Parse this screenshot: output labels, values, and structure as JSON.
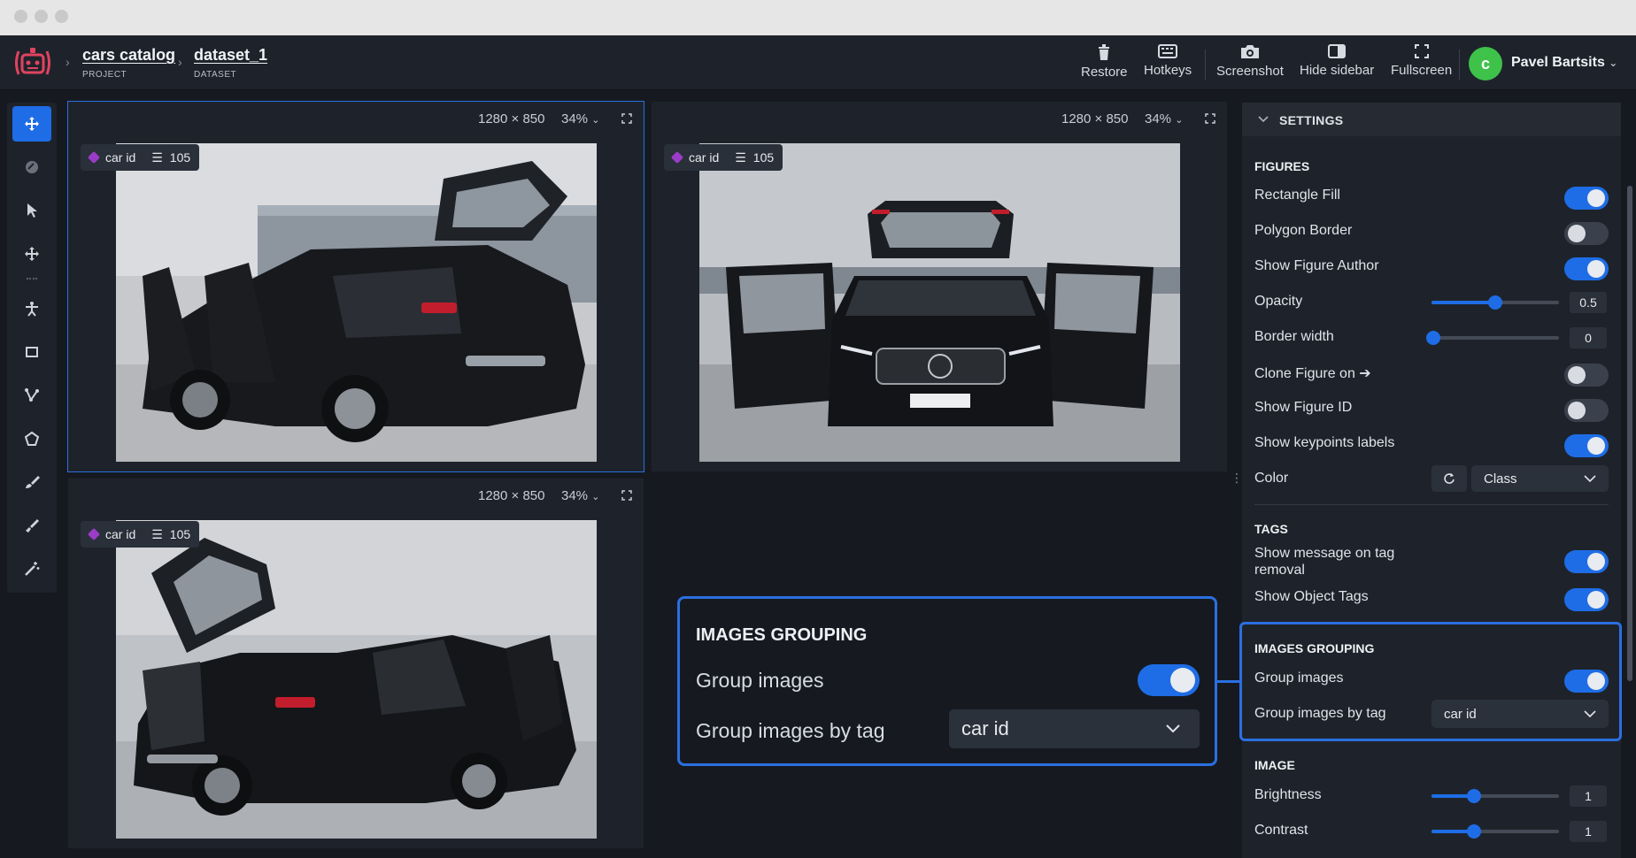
{
  "breadcrumb": [
    {
      "title": "cars catalog",
      "sub": "PROJECT"
    },
    {
      "title": "dataset_1",
      "sub": "DATASET"
    }
  ],
  "header_buttons": {
    "restore": "Restore",
    "hotkeys": "Hotkeys",
    "screenshot": "Screenshot",
    "hide_sidebar": "Hide sidebar",
    "fullscreen": "Fullscreen"
  },
  "user": {
    "initial": "c",
    "name": "Pavel Bartsits"
  },
  "tools": [
    "move-icon",
    "magic-fill-icon",
    "pointer-icon",
    "drag-icon",
    "keypoint-icon",
    "rectangle-icon",
    "polyline-icon",
    "polygon-icon",
    "brush-icon",
    "eraser-icon",
    "smart-tool-icon"
  ],
  "panels": [
    {
      "size": "1280 × 850",
      "zoom": "34%",
      "tag": "car id",
      "count": "105"
    },
    {
      "size": "1280 × 850",
      "zoom": "34%",
      "tag": "car id",
      "count": "105"
    },
    {
      "size": "1280 × 850",
      "zoom": "34%",
      "tag": "car id",
      "count": "105"
    }
  ],
  "callout": {
    "title": "IMAGES GROUPING",
    "group_images": "Group images",
    "group_by_tag": "Group images by tag",
    "tag_value": "car id"
  },
  "settings": {
    "title": "SETTINGS",
    "figures_title": "FIGURES",
    "rectangle_fill": "Rectangle Fill",
    "polygon_border": "Polygon Border",
    "show_figure_author": "Show Figure Author",
    "opacity": "Opacity",
    "opacity_value": "0.5",
    "border_width": "Border width",
    "border_width_value": "0",
    "clone_figure_on": "Clone Figure on ➔",
    "show_figure_id": "Show Figure ID",
    "show_keypoints_labels": "Show keypoints labels",
    "color": "Color",
    "color_mode": "Class",
    "tags_title": "TAGS",
    "show_message_on_tag_removal": "Show message on tag removal",
    "show_object_tags": "Show Object Tags",
    "grouping_title": "IMAGES GROUPING",
    "group_images": "Group images",
    "group_images_by_tag": "Group images by tag",
    "group_tag_value": "car id",
    "image_title": "IMAGE",
    "brightness": "Brightness",
    "brightness_value": "1",
    "contrast": "Contrast",
    "contrast_value": "1"
  },
  "toggles": {
    "rectangle_fill": true,
    "polygon_border": false,
    "show_figure_author": true,
    "clone_figure_on": false,
    "show_figure_id": false,
    "show_keypoints_labels": true,
    "show_message_on_tag_removal": true,
    "show_object_tags": true,
    "group_images": true
  },
  "sliders": {
    "opacity": 0.5,
    "border_width": 0,
    "brightness": 1,
    "contrast": 1
  },
  "colors": {
    "accent": "#1e6de6",
    "highlight": "#2b6fe0",
    "background": "#161a20",
    "panel": "#1e232b",
    "avatar": "#3ec24a",
    "tag_dot": "#9b3cc7"
  }
}
